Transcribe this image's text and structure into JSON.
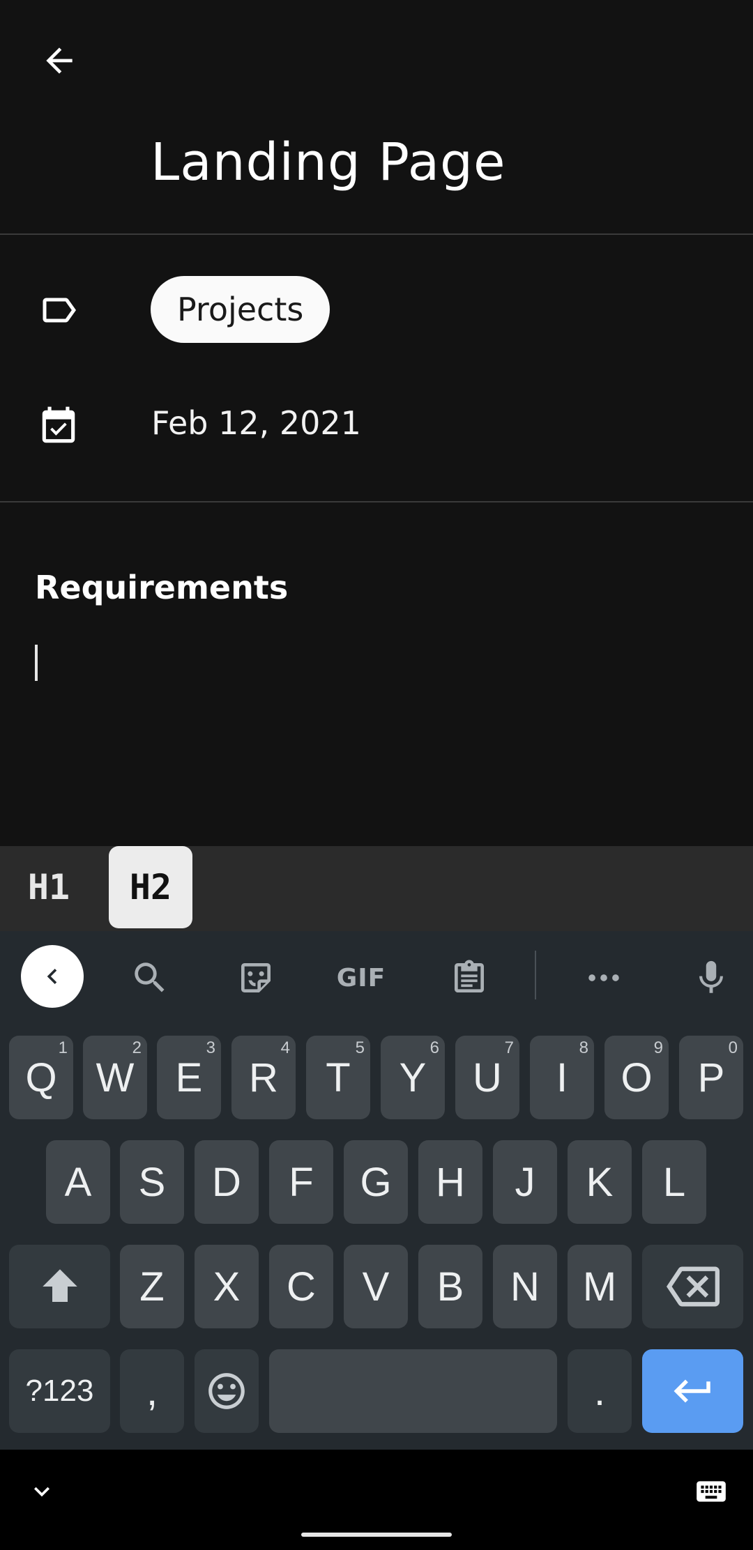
{
  "header": {
    "title": "Landing Page",
    "back_icon": "arrow-left-icon"
  },
  "details": {
    "tag_icon": "label-outline-icon",
    "tag": "Projects",
    "date_icon": "calendar-check-icon",
    "date": "Feb 12, 2021"
  },
  "body": {
    "section_title": "Requirements",
    "content": ""
  },
  "format_bar": {
    "h1": "H1",
    "h2": "H2",
    "active": "H2"
  },
  "keyboard": {
    "toolbar": {
      "gif": "GIF",
      "icons": [
        "chevron-left-icon",
        "search-icon",
        "sticker-icon",
        "gif-icon",
        "clipboard-icon",
        "more-horizontal-icon",
        "microphone-icon"
      ]
    },
    "row1": [
      {
        "label": "Q",
        "hint": "1"
      },
      {
        "label": "W",
        "hint": "2"
      },
      {
        "label": "E",
        "hint": "3"
      },
      {
        "label": "R",
        "hint": "4"
      },
      {
        "label": "T",
        "hint": "5"
      },
      {
        "label": "Y",
        "hint": "6"
      },
      {
        "label": "U",
        "hint": "7"
      },
      {
        "label": "I",
        "hint": "8"
      },
      {
        "label": "O",
        "hint": "9"
      },
      {
        "label": "P",
        "hint": "0"
      }
    ],
    "row2": [
      "A",
      "S",
      "D",
      "F",
      "G",
      "H",
      "J",
      "K",
      "L"
    ],
    "row3": [
      "Z",
      "X",
      "C",
      "V",
      "B",
      "N",
      "M"
    ],
    "row4": {
      "symbols": "?123",
      "comma": ",",
      "period": "."
    },
    "colors": {
      "background": "#242a2f",
      "key": "#40464b",
      "enter": "#5a9cf2"
    }
  },
  "navbar": {
    "icons": [
      "chevron-down-icon",
      "keyboard-icon"
    ]
  }
}
